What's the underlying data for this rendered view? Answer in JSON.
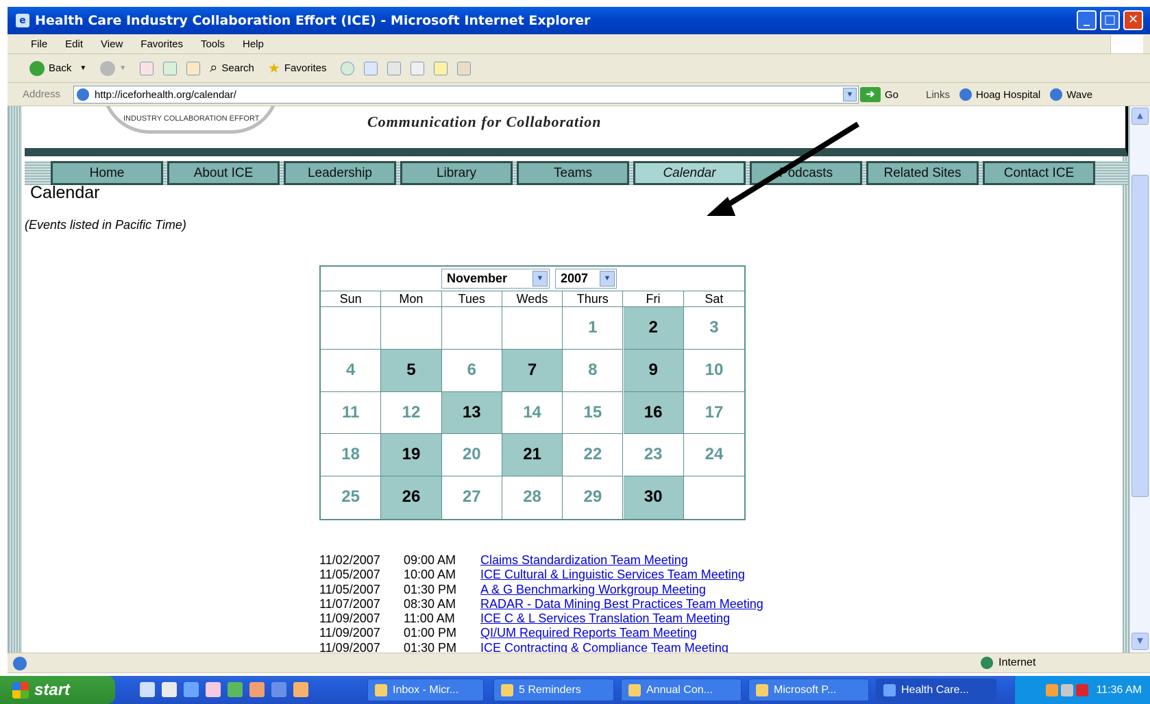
{
  "window": {
    "title": "Health Care Industry Collaboration Effort (ICE) - Microsoft Internet Explorer"
  },
  "menu": [
    "File",
    "Edit",
    "View",
    "Favorites",
    "Tools",
    "Help"
  ],
  "toolbar": {
    "back": "Back",
    "search": "Search",
    "favorites": "Favorites"
  },
  "address": {
    "label": "Address",
    "url": "http://iceforhealth.org/calendar/",
    "go": "Go",
    "links_label": "Links",
    "links": [
      "Hoag Hospital",
      "Wave"
    ]
  },
  "site": {
    "logo_text": "INDUSTRY COLLABORATION EFFORT",
    "tagline": "Communication for Collaboration",
    "nav": [
      "Home",
      "About ICE",
      "Leadership",
      "Library",
      "Teams",
      "Calendar",
      "Podcasts",
      "Related Sites",
      "Contact ICE"
    ],
    "active_nav": "Calendar"
  },
  "page": {
    "title": "Calendar",
    "timezone_note": "(Events listed in Pacific Time)"
  },
  "calendar": {
    "month": "November",
    "year": "2007",
    "weekdays": [
      "Sun",
      "Mon",
      "Tues",
      "Weds",
      "Thurs",
      "Fri",
      "Sat"
    ],
    "weeks": [
      [
        "",
        "",
        "",
        "",
        "1",
        "2",
        "3"
      ],
      [
        "4",
        "5",
        "6",
        "7",
        "8",
        "9",
        "10"
      ],
      [
        "11",
        "12",
        "13",
        "14",
        "15",
        "16",
        "17"
      ],
      [
        "18",
        "19",
        "20",
        "21",
        "22",
        "23",
        "24"
      ],
      [
        "25",
        "26",
        "27",
        "28",
        "29",
        "30",
        ""
      ]
    ],
    "event_days": [
      "2",
      "5",
      "7",
      "9",
      "13",
      "16",
      "19",
      "21",
      "26",
      "30"
    ]
  },
  "events": [
    {
      "date": "11/02/2007",
      "time": "09:00 AM",
      "title": "Claims Standardization Team Meeting"
    },
    {
      "date": "11/05/2007",
      "time": "10:00 AM",
      "title": "ICE Cultural & Linguistic Services Team Meeting"
    },
    {
      "date": "11/05/2007",
      "time": "01:30 PM",
      "title": "A & G Benchmarking Workgroup Meeting"
    },
    {
      "date": "11/07/2007",
      "time": "08:30 AM",
      "title": "RADAR - Data Mining Best Practices Team Meeting"
    },
    {
      "date": "11/09/2007",
      "time": "11:00 AM",
      "title": "ICE C & L Services Translation Team Meeting"
    },
    {
      "date": "11/09/2007",
      "time": "01:00 PM",
      "title": "QI/UM Required Reports Team Meeting"
    },
    {
      "date": "11/09/2007",
      "time": "01:30 PM",
      "title": "ICE Contracting & Compliance Team Meeting"
    }
  ],
  "status": {
    "zone": "Internet"
  },
  "taskbar": {
    "start": "start",
    "tasks": [
      "Inbox - Micr...",
      "5 Reminders",
      "Annual Con...",
      "Microsoft P...",
      "Health Care..."
    ],
    "active_task": "Health Care...",
    "clock": "11:36 AM"
  }
}
